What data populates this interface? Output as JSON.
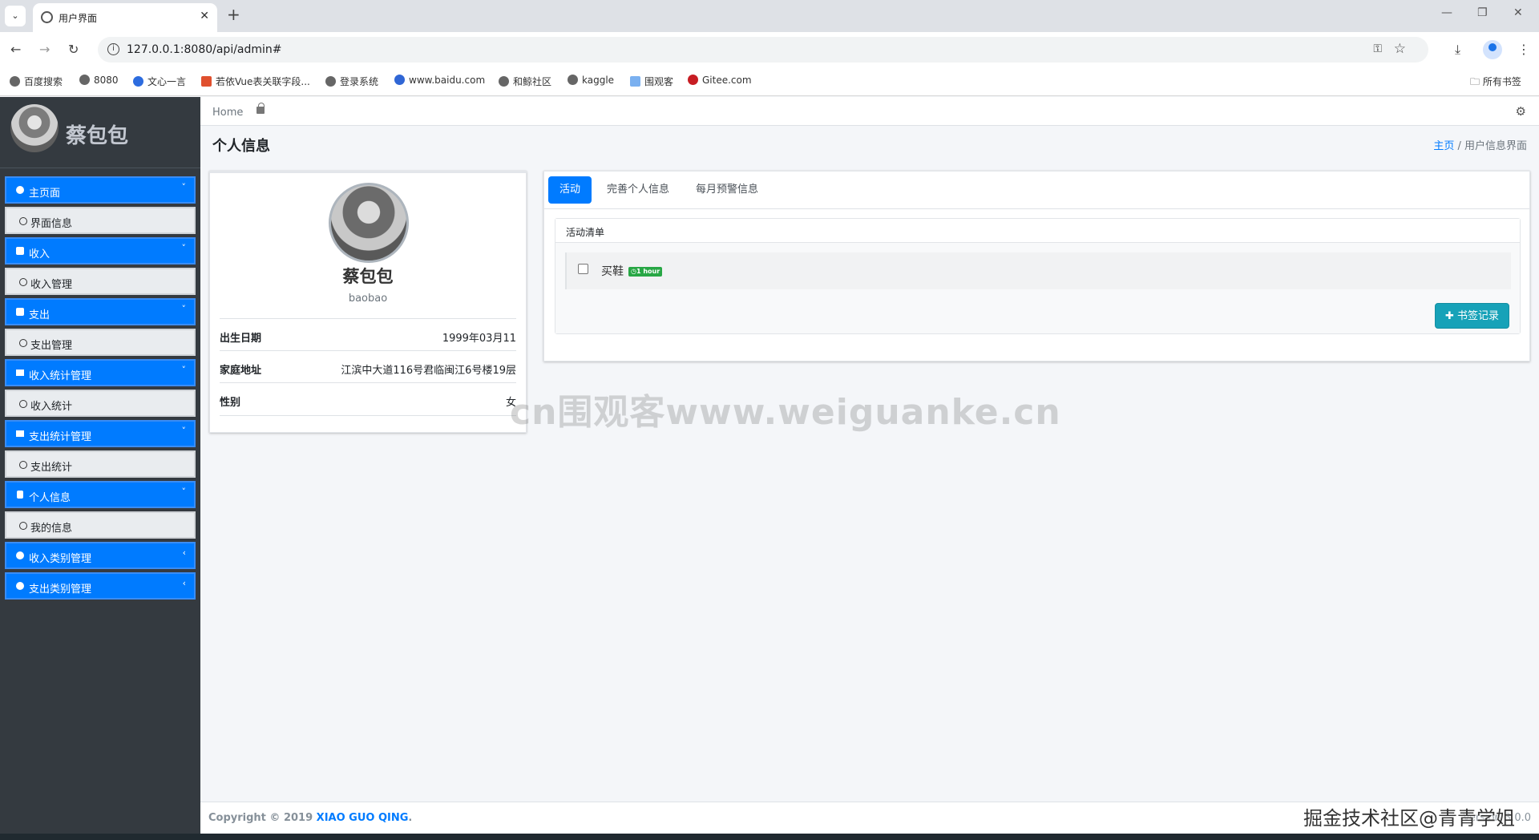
{
  "browser": {
    "tab_title": "用户界面",
    "url": "127.0.0.1:8080/api/admin#",
    "bookmarks": [
      "百度搜索",
      "8080",
      "文心一言",
      "若依Vue表关联字段...",
      "登录系统",
      "www.baidu.com",
      "和鲸社区",
      "kaggle",
      "围观客",
      "Gitee.com"
    ],
    "all_bookmarks": "所有书签"
  },
  "sidebar": {
    "brand_name": "蔡包包",
    "items": [
      {
        "label": "主页面",
        "type": "menu",
        "arrow": "˅",
        "icon": "apple-icon"
      },
      {
        "label": "界面信息",
        "type": "sub"
      },
      {
        "label": "收入",
        "type": "menu",
        "arrow": "˅",
        "icon": "plus-square-icon"
      },
      {
        "label": "收入管理",
        "type": "sub"
      },
      {
        "label": "支出",
        "type": "menu",
        "arrow": "˅",
        "icon": "minus-square-icon"
      },
      {
        "label": "支出管理",
        "type": "sub"
      },
      {
        "label": "收入统计管理",
        "type": "menu",
        "arrow": "˅",
        "icon": "bar-chart-icon"
      },
      {
        "label": "收入统计",
        "type": "sub"
      },
      {
        "label": "支出统计管理",
        "type": "menu",
        "arrow": "˅",
        "icon": "bar-chart-icon"
      },
      {
        "label": "支出统计",
        "type": "sub"
      },
      {
        "label": "个人信息",
        "type": "menu",
        "arrow": "˅",
        "icon": "lock-icon"
      },
      {
        "label": "我的信息",
        "type": "sub"
      },
      {
        "label": "收入类别管理",
        "type": "menu",
        "arrow": "‹",
        "icon": "circle-icon"
      },
      {
        "label": "支出类别管理",
        "type": "menu",
        "arrow": "‹",
        "icon": "circle-icon"
      }
    ]
  },
  "header": {
    "home": "Home",
    "page_title": "个人信息",
    "breadcrumb_home": "主页",
    "breadcrumb_current": "用户信息界面"
  },
  "profile": {
    "name": "蔡包包",
    "username": "baobao",
    "fields": [
      {
        "label": "出生日期",
        "value": "1999年03月11"
      },
      {
        "label": "家庭地址",
        "value": "江滨中大道116号君临闽江6号楼19层"
      },
      {
        "label": "性别",
        "value": "女"
      }
    ]
  },
  "tabs": [
    {
      "label": "活动",
      "active": true
    },
    {
      "label": "完善个人信息",
      "active": false
    },
    {
      "label": "每月预警信息",
      "active": false
    }
  ],
  "todo": {
    "title": "活动清单",
    "items": [
      {
        "text": "买鞋",
        "badge": "1 hour",
        "checked": false
      }
    ],
    "button": "书签记录"
  },
  "watermark": "cn围观客www.weiguanke.cn",
  "footer": {
    "copyright_prefix": "Copyright © 2019",
    "owner": "XIAO GUO QING",
    "suffix": ".",
    "version": "Version 3.0.0",
    "overlay": "掘金技术社区@青青学姐"
  },
  "colors": {
    "primary": "#007bff",
    "sidebar_bg": "#343a40",
    "info": "#17a2b8",
    "success": "#28a745"
  }
}
